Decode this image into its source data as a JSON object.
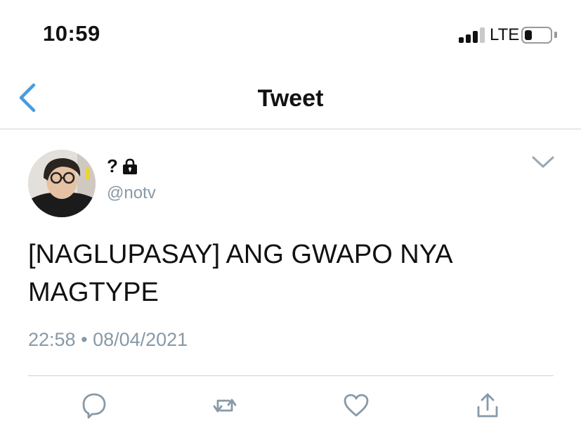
{
  "status_bar": {
    "time": "10:59",
    "network": "LTE",
    "battery_level": 0.3
  },
  "nav": {
    "title": "Tweet",
    "back_icon": "chevron-left-icon"
  },
  "tweet": {
    "display_name": "?",
    "protected_icon": "lock-icon",
    "handle": "@notv",
    "text_line1": "[NAGLUPASAY] ANG GWAPO NYA",
    "text_line2": "MAGTYPE",
    "time": "22:58",
    "separator": "•",
    "date": "08/04/2021",
    "menu_icon": "chevron-down-icon"
  },
  "actions": [
    {
      "name": "reply",
      "icon": "reply-icon"
    },
    {
      "name": "retweet",
      "icon": "retweet-icon"
    },
    {
      "name": "like",
      "icon": "heart-icon"
    },
    {
      "name": "share",
      "icon": "share-icon"
    }
  ],
  "colors": {
    "accent": "#1d9bf0",
    "secondary_text": "#8899a6",
    "divider": "#cfd3d6"
  }
}
